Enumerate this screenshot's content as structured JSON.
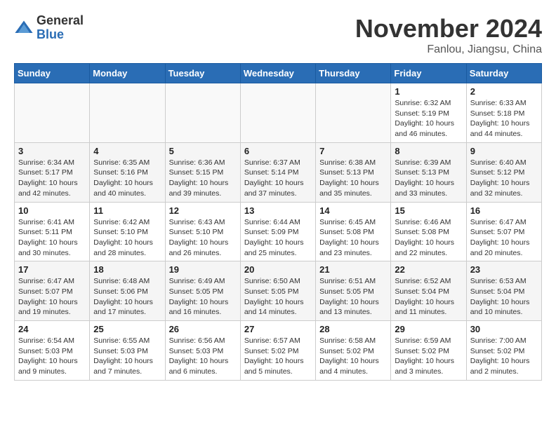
{
  "header": {
    "logo_general": "General",
    "logo_blue": "Blue",
    "month": "November 2024",
    "location": "Fanlou, Jiangsu, China"
  },
  "weekdays": [
    "Sunday",
    "Monday",
    "Tuesday",
    "Wednesday",
    "Thursday",
    "Friday",
    "Saturday"
  ],
  "weeks": [
    [
      {
        "day": "",
        "info": ""
      },
      {
        "day": "",
        "info": ""
      },
      {
        "day": "",
        "info": ""
      },
      {
        "day": "",
        "info": ""
      },
      {
        "day": "",
        "info": ""
      },
      {
        "day": "1",
        "info": "Sunrise: 6:32 AM\nSunset: 5:19 PM\nDaylight: 10 hours and 46 minutes."
      },
      {
        "day": "2",
        "info": "Sunrise: 6:33 AM\nSunset: 5:18 PM\nDaylight: 10 hours and 44 minutes."
      }
    ],
    [
      {
        "day": "3",
        "info": "Sunrise: 6:34 AM\nSunset: 5:17 PM\nDaylight: 10 hours and 42 minutes."
      },
      {
        "day": "4",
        "info": "Sunrise: 6:35 AM\nSunset: 5:16 PM\nDaylight: 10 hours and 40 minutes."
      },
      {
        "day": "5",
        "info": "Sunrise: 6:36 AM\nSunset: 5:15 PM\nDaylight: 10 hours and 39 minutes."
      },
      {
        "day": "6",
        "info": "Sunrise: 6:37 AM\nSunset: 5:14 PM\nDaylight: 10 hours and 37 minutes."
      },
      {
        "day": "7",
        "info": "Sunrise: 6:38 AM\nSunset: 5:13 PM\nDaylight: 10 hours and 35 minutes."
      },
      {
        "day": "8",
        "info": "Sunrise: 6:39 AM\nSunset: 5:13 PM\nDaylight: 10 hours and 33 minutes."
      },
      {
        "day": "9",
        "info": "Sunrise: 6:40 AM\nSunset: 5:12 PM\nDaylight: 10 hours and 32 minutes."
      }
    ],
    [
      {
        "day": "10",
        "info": "Sunrise: 6:41 AM\nSunset: 5:11 PM\nDaylight: 10 hours and 30 minutes."
      },
      {
        "day": "11",
        "info": "Sunrise: 6:42 AM\nSunset: 5:10 PM\nDaylight: 10 hours and 28 minutes."
      },
      {
        "day": "12",
        "info": "Sunrise: 6:43 AM\nSunset: 5:10 PM\nDaylight: 10 hours and 26 minutes."
      },
      {
        "day": "13",
        "info": "Sunrise: 6:44 AM\nSunset: 5:09 PM\nDaylight: 10 hours and 25 minutes."
      },
      {
        "day": "14",
        "info": "Sunrise: 6:45 AM\nSunset: 5:08 PM\nDaylight: 10 hours and 23 minutes."
      },
      {
        "day": "15",
        "info": "Sunrise: 6:46 AM\nSunset: 5:08 PM\nDaylight: 10 hours and 22 minutes."
      },
      {
        "day": "16",
        "info": "Sunrise: 6:47 AM\nSunset: 5:07 PM\nDaylight: 10 hours and 20 minutes."
      }
    ],
    [
      {
        "day": "17",
        "info": "Sunrise: 6:47 AM\nSunset: 5:07 PM\nDaylight: 10 hours and 19 minutes."
      },
      {
        "day": "18",
        "info": "Sunrise: 6:48 AM\nSunset: 5:06 PM\nDaylight: 10 hours and 17 minutes."
      },
      {
        "day": "19",
        "info": "Sunrise: 6:49 AM\nSunset: 5:05 PM\nDaylight: 10 hours and 16 minutes."
      },
      {
        "day": "20",
        "info": "Sunrise: 6:50 AM\nSunset: 5:05 PM\nDaylight: 10 hours and 14 minutes."
      },
      {
        "day": "21",
        "info": "Sunrise: 6:51 AM\nSunset: 5:05 PM\nDaylight: 10 hours and 13 minutes."
      },
      {
        "day": "22",
        "info": "Sunrise: 6:52 AM\nSunset: 5:04 PM\nDaylight: 10 hours and 11 minutes."
      },
      {
        "day": "23",
        "info": "Sunrise: 6:53 AM\nSunset: 5:04 PM\nDaylight: 10 hours and 10 minutes."
      }
    ],
    [
      {
        "day": "24",
        "info": "Sunrise: 6:54 AM\nSunset: 5:03 PM\nDaylight: 10 hours and 9 minutes."
      },
      {
        "day": "25",
        "info": "Sunrise: 6:55 AM\nSunset: 5:03 PM\nDaylight: 10 hours and 7 minutes."
      },
      {
        "day": "26",
        "info": "Sunrise: 6:56 AM\nSunset: 5:03 PM\nDaylight: 10 hours and 6 minutes."
      },
      {
        "day": "27",
        "info": "Sunrise: 6:57 AM\nSunset: 5:02 PM\nDaylight: 10 hours and 5 minutes."
      },
      {
        "day": "28",
        "info": "Sunrise: 6:58 AM\nSunset: 5:02 PM\nDaylight: 10 hours and 4 minutes."
      },
      {
        "day": "29",
        "info": "Sunrise: 6:59 AM\nSunset: 5:02 PM\nDaylight: 10 hours and 3 minutes."
      },
      {
        "day": "30",
        "info": "Sunrise: 7:00 AM\nSunset: 5:02 PM\nDaylight: 10 hours and 2 minutes."
      }
    ]
  ]
}
